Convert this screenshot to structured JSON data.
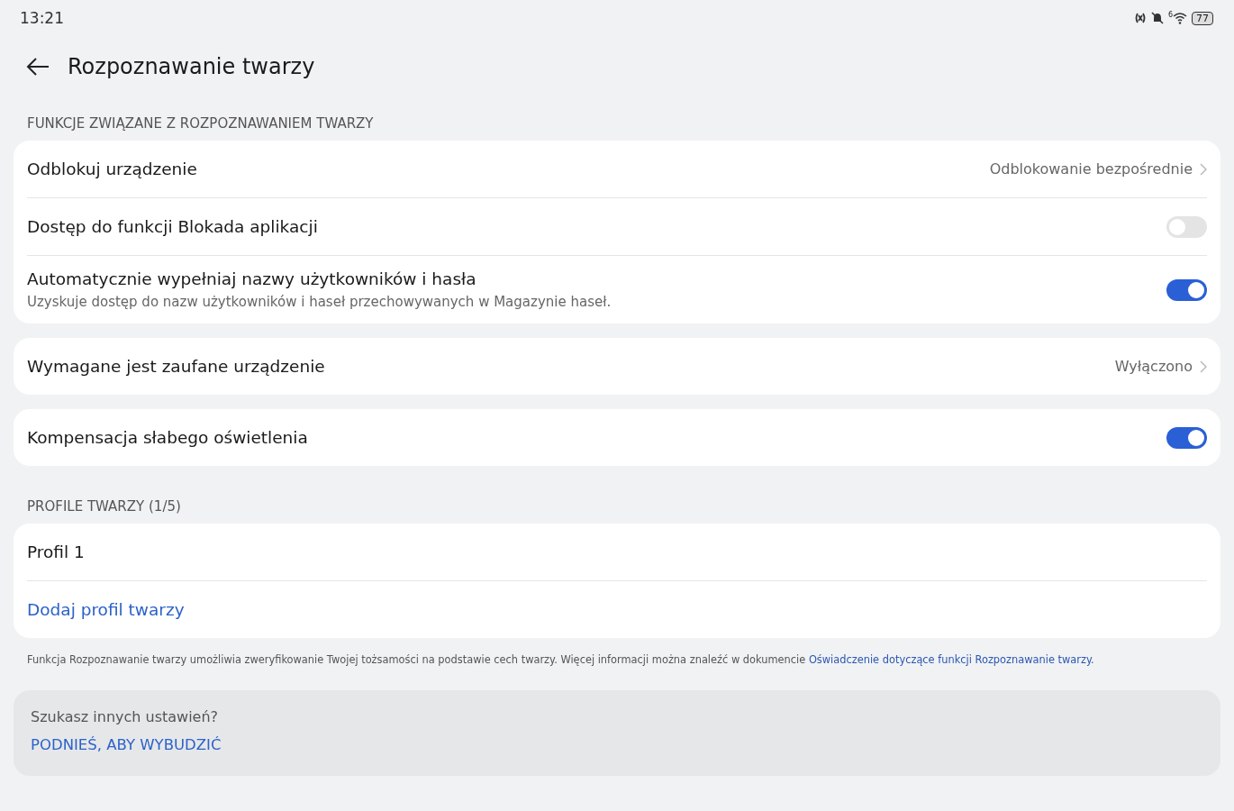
{
  "status_bar": {
    "time": "13:21",
    "wifi_badge": "6",
    "battery": "77"
  },
  "header": {
    "title": "Rozpoznawanie twarzy"
  },
  "blocks": [
    {
      "kind": "section",
      "label": "FUNKCJE ZWIĄZANE Z ROZPOZNAWANIEM TWARZY"
    },
    {
      "kind": "card",
      "rows": [
        {
          "kind": "link",
          "label": "Odblokuj urządzenie",
          "value": "Odblokowanie bezpośrednie"
        },
        {
          "kind": "toggle",
          "label": "Dostęp do funkcji Blokada aplikacji",
          "on": false
        },
        {
          "kind": "toggle",
          "label": "Automatycznie wypełniaj nazwy użytkowników i hasła",
          "sub": "Uzyskuje dostęp do nazw użytkowników i haseł przechowywanych w Magazynie haseł.",
          "on": true
        }
      ]
    },
    {
      "kind": "card",
      "rows": [
        {
          "kind": "link",
          "label": "Wymagane jest zaufane urządzenie",
          "value": "Wyłączono"
        }
      ]
    },
    {
      "kind": "card",
      "rows": [
        {
          "kind": "toggle",
          "label": "Kompensacja słabego oświetlenia",
          "on": true
        }
      ]
    },
    {
      "kind": "section",
      "label": "PROFILE TWARZY (1/5)"
    },
    {
      "kind": "card",
      "rows": [
        {
          "kind": "plain",
          "label": "Profil 1"
        },
        {
          "kind": "action",
          "label": "Dodaj profil twarzy"
        }
      ]
    },
    {
      "kind": "note",
      "text": "Funkcja Rozpoznawanie twarzy umożliwia zweryfikowanie Twojej tożsamości na podstawie cech twarzy. Więcej informacji można znaleźć w dokumencie",
      "link": "Oświadczenie dotyczące funkcji Rozpoznawanie twarzy",
      "end": "."
    },
    {
      "kind": "suggest",
      "question": "Szukasz innych ustawień?",
      "link": "PODNIEŚ, ABY WYBUDZIĆ"
    }
  ]
}
